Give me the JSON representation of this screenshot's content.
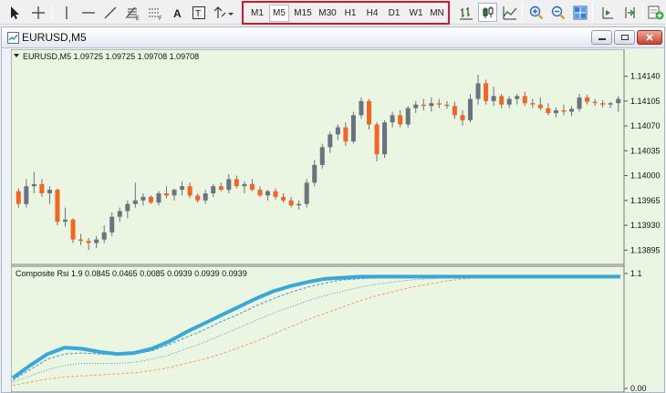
{
  "toolbar": {
    "tools": [
      "cursor-icon",
      "crosshair-icon",
      "vertical-line-icon",
      "horizontal-line-icon",
      "trend-line-icon",
      "fibonacci-icon",
      "channel-icon",
      "text-icon",
      "text-label-icon",
      "arrows-icon"
    ],
    "text_tool": "A",
    "text_label_tool": "T",
    "timeframes": [
      "M1",
      "M5",
      "M15",
      "M30",
      "H1",
      "H4",
      "D1",
      "W1",
      "MN"
    ],
    "active_timeframe": "M5",
    "right_tools": [
      "bar-chart-icon",
      "candlestick-icon",
      "line-chart-icon",
      "zoom-in-icon",
      "zoom-out-icon",
      "tile-windows-icon",
      "chart-shift-icon",
      "auto-scroll-icon",
      "new-chart-icon"
    ]
  },
  "window": {
    "title": "EURUSD,M5"
  },
  "colors": {
    "plot_bg": "#eaf5e2",
    "bull": "#6b7380",
    "bear": "#f26522",
    "rsi_main": "#3aa7d6",
    "rsi_signal": "#4f8fcc",
    "rsi_slow": "#f2a35a"
  },
  "chart_data": [
    {
      "type": "candlestick",
      "legend": "EURUSD,M5  1.09725 1.09725 1.09708 1.09708",
      "yticks": [
        "1.14140",
        "1.14105",
        "1.14070",
        "1.14035",
        "1.14000",
        "1.13965",
        "1.13930",
        "1.13895"
      ],
      "ylim": [
        1.1388,
        1.1416
      ],
      "candles": [
        [
          1.13978,
          1.13982,
          1.13955,
          1.1396
        ],
        [
          1.1396,
          1.13995,
          1.13955,
          1.13985
        ],
        [
          1.13985,
          1.14005,
          1.13975,
          1.13988
        ],
        [
          1.13988,
          1.13995,
          1.1397,
          1.13975
        ],
        [
          1.13975,
          1.13985,
          1.1396,
          1.1398
        ],
        [
          1.1398,
          1.13982,
          1.1393,
          1.13935
        ],
        [
          1.13935,
          1.13955,
          1.13928,
          1.13938
        ],
        [
          1.13938,
          1.1394,
          1.13905,
          1.1391
        ],
        [
          1.1391,
          1.13918,
          1.13902,
          1.13908
        ],
        [
          1.13908,
          1.13912,
          1.13895,
          1.13905
        ],
        [
          1.13905,
          1.13915,
          1.13898,
          1.1391
        ],
        [
          1.1391,
          1.1393,
          1.13905,
          1.1392
        ],
        [
          1.1392,
          1.13948,
          1.13915,
          1.13942
        ],
        [
          1.13942,
          1.13955,
          1.13935,
          1.1395
        ],
        [
          1.1395,
          1.13965,
          1.1394,
          1.1396
        ],
        [
          1.1396,
          1.1399,
          1.13955,
          1.13965
        ],
        [
          1.13965,
          1.13975,
          1.13958,
          1.1397
        ],
        [
          1.1397,
          1.13972,
          1.1396,
          1.13962
        ],
        [
          1.13962,
          1.13978,
          1.13958,
          1.13975
        ],
        [
          1.13975,
          1.13985,
          1.13968,
          1.13972
        ],
        [
          1.13972,
          1.13982,
          1.13965,
          1.1398
        ],
        [
          1.1398,
          1.13992,
          1.13972,
          1.13985
        ],
        [
          1.13985,
          1.1399,
          1.13968,
          1.13972
        ],
        [
          1.13972,
          1.13975,
          1.13962,
          1.13965
        ],
        [
          1.13965,
          1.1398,
          1.1396,
          1.13975
        ],
        [
          1.13975,
          1.13988,
          1.1397,
          1.13985
        ],
        [
          1.13985,
          1.1399,
          1.13978,
          1.1398
        ],
        [
          1.1398,
          1.14002,
          1.13975,
          1.13995
        ],
        [
          1.13995,
          1.14,
          1.13982,
          1.13985
        ],
        [
          1.13985,
          1.13992,
          1.13975,
          1.13988
        ],
        [
          1.13988,
          1.13995,
          1.13978,
          1.1398
        ],
        [
          1.1398,
          1.13985,
          1.1397,
          1.13972
        ],
        [
          1.13972,
          1.1398,
          1.13965,
          1.13978
        ],
        [
          1.13978,
          1.13982,
          1.13966,
          1.1397
        ],
        [
          1.1397,
          1.13975,
          1.13962,
          1.13965
        ],
        [
          1.13965,
          1.1397,
          1.13955,
          1.13958
        ],
        [
          1.13958,
          1.13965,
          1.13952,
          1.1396
        ],
        [
          1.1396,
          1.13995,
          1.13955,
          1.1399
        ],
        [
          1.1399,
          1.14022,
          1.13985,
          1.14015
        ],
        [
          1.14015,
          1.14045,
          1.1401,
          1.1404
        ],
        [
          1.1404,
          1.14062,
          1.14032,
          1.14058
        ],
        [
          1.14058,
          1.14072,
          1.1405,
          1.14068
        ],
        [
          1.14068,
          1.14075,
          1.14042,
          1.14048
        ],
        [
          1.14048,
          1.1409,
          1.14045,
          1.14085
        ],
        [
          1.14085,
          1.1411,
          1.1408,
          1.14105
        ],
        [
          1.14105,
          1.14108,
          1.14065,
          1.14072
        ],
        [
          1.14072,
          1.14075,
          1.1402,
          1.1403
        ],
        [
          1.1403,
          1.14078,
          1.14025,
          1.14075
        ],
        [
          1.14075,
          1.1409,
          1.14068,
          1.14085
        ],
        [
          1.14085,
          1.14092,
          1.14068,
          1.14072
        ],
        [
          1.14072,
          1.14098,
          1.14068,
          1.14095
        ],
        [
          1.14095,
          1.14105,
          1.14088,
          1.141
        ],
        [
          1.141,
          1.14108,
          1.14092,
          1.14098
        ],
        [
          1.14098,
          1.1411,
          1.1409,
          1.14102
        ],
        [
          1.14102,
          1.14108,
          1.14095,
          1.141
        ],
        [
          1.141,
          1.14105,
          1.14094,
          1.14098
        ],
        [
          1.14098,
          1.14104,
          1.1408,
          1.14085
        ],
        [
          1.14085,
          1.14092,
          1.1407,
          1.14078
        ],
        [
          1.14078,
          1.14115,
          1.14075,
          1.14108
        ],
        [
          1.14108,
          1.14142,
          1.141,
          1.1413
        ],
        [
          1.1413,
          1.14135,
          1.141,
          1.14105
        ],
        [
          1.14105,
          1.14125,
          1.14098,
          1.14112
        ],
        [
          1.14112,
          1.14115,
          1.14095,
          1.141
        ],
        [
          1.141,
          1.14112,
          1.14095,
          1.14108
        ],
        [
          1.14108,
          1.14115,
          1.141,
          1.14112
        ],
        [
          1.14112,
          1.14118,
          1.14098,
          1.14102
        ],
        [
          1.14102,
          1.14108,
          1.14095,
          1.141
        ],
        [
          1.141,
          1.1411,
          1.14092,
          1.14095
        ],
        [
          1.14095,
          1.14102,
          1.14085,
          1.14088
        ],
        [
          1.14088,
          1.14096,
          1.14082,
          1.14092
        ],
        [
          1.14092,
          1.141,
          1.14085,
          1.1409
        ],
        [
          1.1409,
          1.14098,
          1.14084,
          1.14094
        ],
        [
          1.14094,
          1.14115,
          1.1409,
          1.1411
        ],
        [
          1.1411,
          1.14114,
          1.141,
          1.14104
        ],
        [
          1.14104,
          1.14108,
          1.14098,
          1.14102
        ],
        [
          1.14102,
          1.14106,
          1.14096,
          1.141
        ],
        [
          1.141,
          1.14104,
          1.14095,
          1.14102
        ],
        [
          1.14102,
          1.14112,
          1.1409,
          1.14108
        ]
      ]
    },
    {
      "type": "line",
      "legend": "Composite Rsi  1.9 0.0845 0.0465 0.0085 0.0939 0.0939 0.0939",
      "yticks": [
        "1.1",
        "0.00"
      ],
      "ylim": [
        0,
        1.1
      ],
      "series": [
        {
          "values": [
            0.1,
            0.22,
            0.33,
            0.39,
            0.38,
            0.35,
            0.33,
            0.34,
            0.38,
            0.45,
            0.54,
            0.62,
            0.7,
            0.78,
            0.86,
            0.93,
            0.98,
            1.02,
            1.05,
            1.06,
            1.07,
            1.07,
            1.07,
            1.07,
            1.07,
            1.07,
            1.07,
            1.07,
            1.07,
            1.07,
            1.07,
            1.07,
            1.07,
            1.07,
            1.07,
            1.07
          ]
        },
        {
          "values": [
            0.08,
            0.18,
            0.28,
            0.33,
            0.34,
            0.33,
            0.32,
            0.33,
            0.36,
            0.42,
            0.49,
            0.56,
            0.64,
            0.71,
            0.79,
            0.86,
            0.92,
            0.97,
            1.01,
            1.04,
            1.05,
            1.06,
            1.06,
            1.07,
            1.07,
            1.07,
            1.07,
            1.07,
            1.07,
            1.07,
            1.07,
            1.07,
            1.07,
            1.07,
            1.07,
            1.07
          ]
        },
        {
          "values": [
            0.06,
            0.12,
            0.18,
            0.22,
            0.24,
            0.24,
            0.24,
            0.25,
            0.28,
            0.32,
            0.38,
            0.44,
            0.51,
            0.58,
            0.65,
            0.72,
            0.78,
            0.84,
            0.89,
            0.93,
            0.97,
            1.0,
            1.02,
            1.04,
            1.05,
            1.06,
            1.06,
            1.07,
            1.07,
            1.07,
            1.07,
            1.07,
            1.07,
            1.07,
            1.07,
            1.07
          ]
        },
        {
          "values": [
            0.03,
            0.06,
            0.09,
            0.11,
            0.12,
            0.13,
            0.14,
            0.15,
            0.17,
            0.2,
            0.24,
            0.28,
            0.33,
            0.39,
            0.45,
            0.52,
            0.59,
            0.66,
            0.72,
            0.78,
            0.84,
            0.89,
            0.93,
            0.97,
            1.0,
            1.03,
            1.05,
            1.06,
            1.07,
            1.07,
            1.07,
            1.07,
            1.07,
            1.07,
            1.07,
            1.07
          ]
        }
      ]
    }
  ]
}
